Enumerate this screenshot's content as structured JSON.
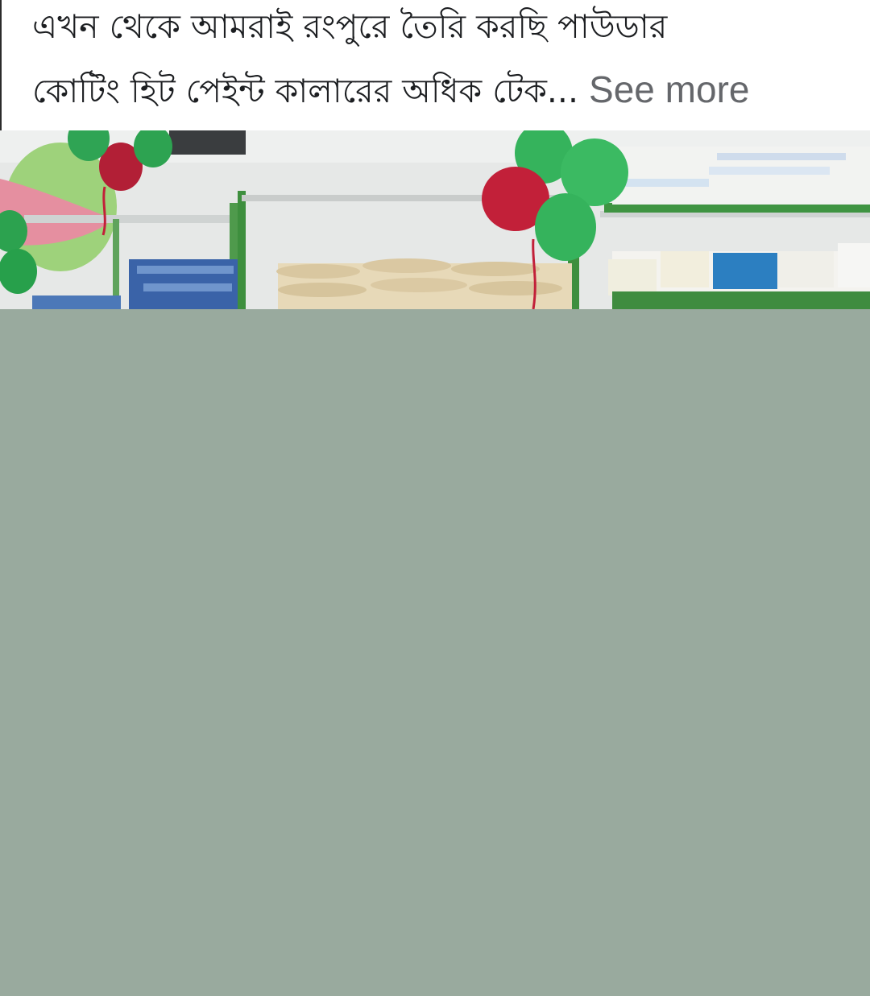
{
  "post": {
    "caption_line1": "এখন থেকে আমরাই রংপুরে তৈরি করছি পাউডার",
    "caption_line2": "কোটিং হিট পেইন্ট কালারের অধিক টেক...",
    "see_more_label": "See more"
  },
  "image": {
    "description_text": "",
    "placeholder_color": "#99aa9e"
  }
}
